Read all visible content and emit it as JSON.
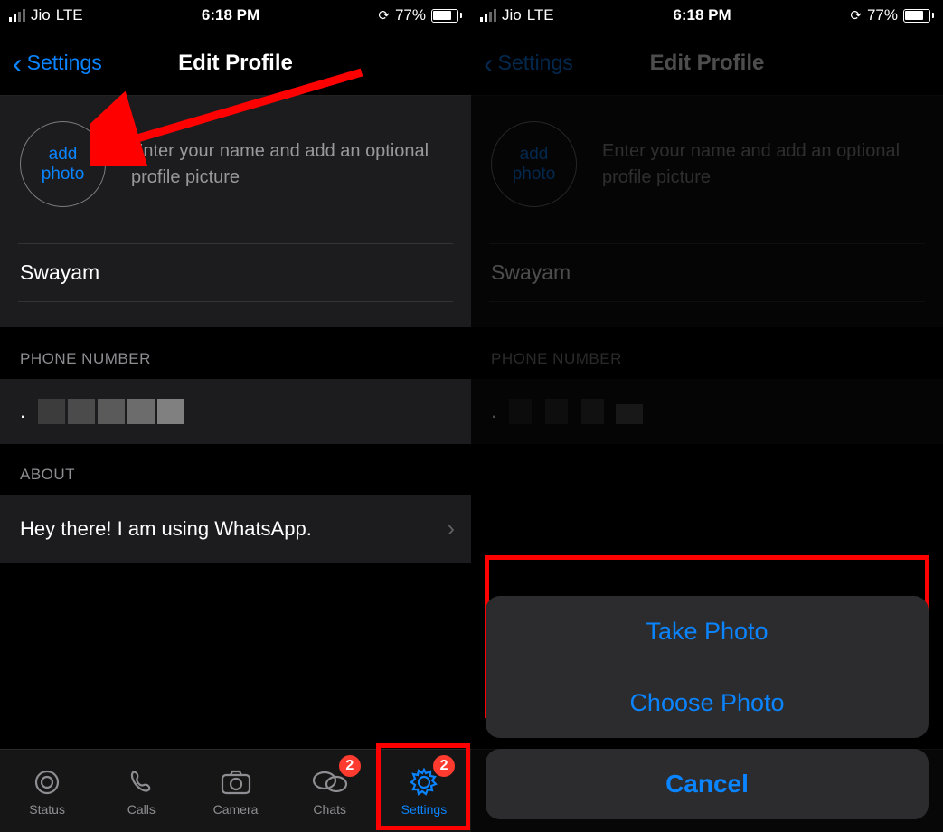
{
  "status": {
    "carrier": "Jio",
    "network": "LTE",
    "time": "6:18 PM",
    "battery_pct": "77%"
  },
  "nav": {
    "back": "Settings",
    "title": "Edit Profile"
  },
  "profile": {
    "add_photo_line1": "add",
    "add_photo_line2": "photo",
    "hint": "Enter your name and add an optional profile picture",
    "name": "Swayam"
  },
  "sections": {
    "phone_header": "PHONE NUMBER",
    "about_header": "ABOUT",
    "about_value": "Hey there! I am using WhatsApp."
  },
  "tabs": {
    "status": "Status",
    "calls": "Calls",
    "camera": "Camera",
    "chats": "Chats",
    "settings": "Settings",
    "chats_badge": "2",
    "settings_badge": "2"
  },
  "sheet": {
    "take": "Take Photo",
    "choose": "Choose Photo",
    "cancel": "Cancel"
  }
}
